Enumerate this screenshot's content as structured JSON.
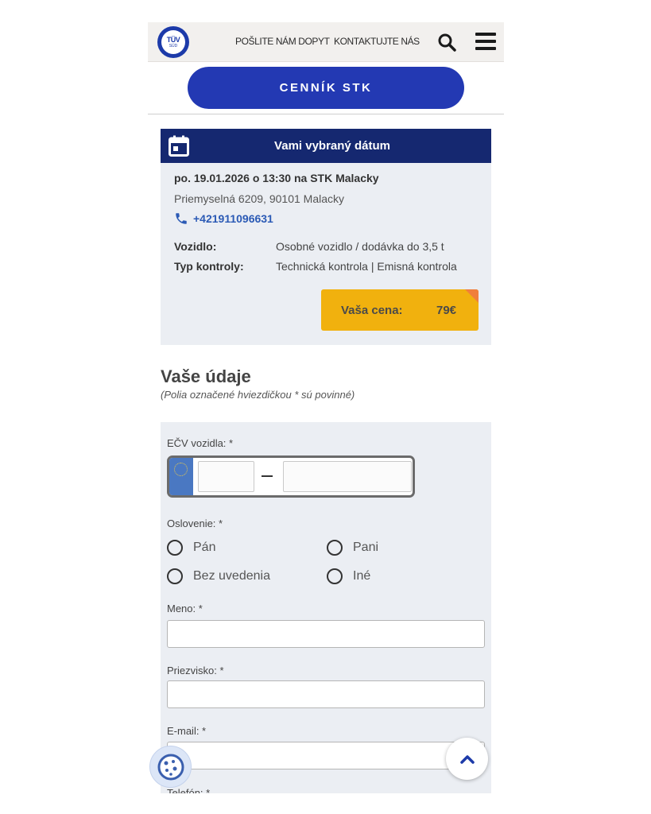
{
  "header": {
    "logo_line1": "TÜV",
    "logo_line2": "SÜD",
    "link_request": "POŠLITE NÁM DOPYT",
    "link_contact": "KONTAKTUJTE NÁS"
  },
  "price_list_button": "CENNÍK STK",
  "date_card": {
    "title": "Vami vybraný dátum",
    "datetime": "po. 19.01.2026 o 13:30 na STK Malacky",
    "address": "Priemyselná 6209, 90101 Malacky",
    "phone": "+421911096631",
    "vehicle_label": "Vozidlo:",
    "vehicle_value": "Osobné vozidlo / dodávka do 3,5 t",
    "inspection_label": "Typ kontroly:",
    "inspection_value": "Technická kontrola | Emisná kontrola",
    "price_label": "Vaša cena:",
    "price_value": "79€"
  },
  "section": {
    "title": "Vaše údaje",
    "subtitle": "(Polia označené hviezdičkou * sú povinné)"
  },
  "form": {
    "plate_label": "EČV vozidla: *",
    "salutation_label": "Oslovenie: *",
    "salutations": [
      "Pán",
      "Pani",
      "Bez uvedenia",
      "Iné"
    ],
    "first_name_label": "Meno: *",
    "last_name_label": "Priezvisko: *",
    "email_label": "E-mail: *",
    "phone_label": "Telefón: *"
  },
  "colors": {
    "brand_blue": "#2339b3",
    "header_navy": "#152870",
    "price_yellow": "#f1b10e",
    "price_corner": "#f07f3c",
    "link_blue": "#2b5ab5"
  },
  "icons": [
    "tuv-logo-icon",
    "search-icon",
    "menu-icon",
    "calendar-icon",
    "phone-icon",
    "eu-flag-icon",
    "cookie-icon",
    "chevron-up-icon"
  ]
}
